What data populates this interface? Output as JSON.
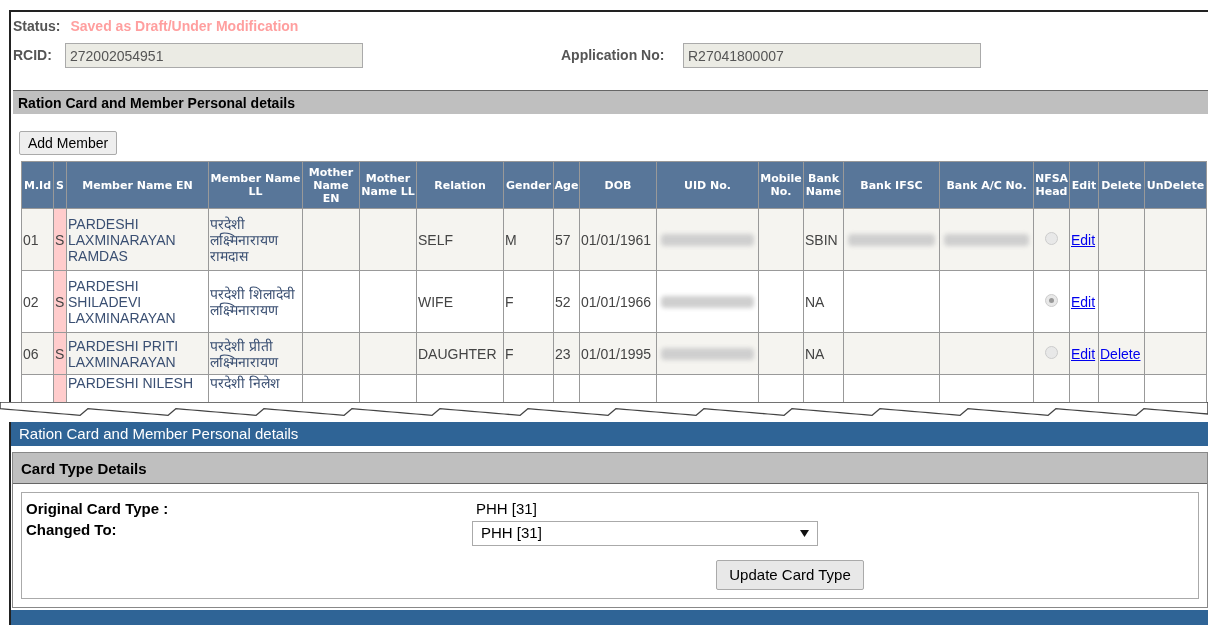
{
  "status": {
    "label": "Status:",
    "value": "Saved as Draft/Under Modification"
  },
  "rcid": {
    "label": "RCID:",
    "value": "272002054951"
  },
  "application_no": {
    "label": "Application No:",
    "value": "R27041800007"
  },
  "section_title": "Ration Card and Member Personal details",
  "add_member_button": "Add Member",
  "table": {
    "columns": [
      "M.Id",
      "S",
      "Member Name EN",
      "Member Name LL",
      "Mother Name EN",
      "Mother Name LL",
      "Relation",
      "Gender",
      "Age",
      "DOB",
      "UID No.",
      "Mobile No.",
      "Bank Name",
      "Bank IFSC",
      "Bank A/C No.",
      "NFSA Head",
      "Edit",
      "Delete",
      "UnDelete"
    ],
    "rows": [
      {
        "mid": "01",
        "s": "S",
        "name_en": "PARDESHI LAXMINARAYAN RAMDAS",
        "name_ll": "परदेशी लक्ष्मिनारायण रामदास",
        "relation": "SELF",
        "gender": "M",
        "age": "57",
        "dob": "01/01/1961",
        "bank_name": "SBIN",
        "bank_redacted": true,
        "nfsa_head_selected": false,
        "edit": "Edit"
      },
      {
        "mid": "02",
        "s": "S",
        "name_en": "PARDESHI SHILADEVI LAXMINARAYAN",
        "name_ll": "परदेशी शिलादेवी लक्ष्मिनारायण",
        "relation": "WIFE",
        "gender": "F",
        "age": "52",
        "dob": "01/01/1966",
        "bank_name": "NA",
        "bank_redacted": false,
        "nfsa_head_selected": true,
        "edit": "Edit"
      },
      {
        "mid": "06",
        "s": "S",
        "name_en": "PARDESHI PRITI LAXMINARAYAN",
        "name_ll": "परदेशी प्रीती लक्ष्मिनारायण",
        "relation": "DAUGHTER",
        "gender": "F",
        "age": "23",
        "dob": "01/01/1995",
        "bank_name": "NA",
        "bank_redacted": false,
        "nfsa_head_selected": false,
        "edit": "Edit",
        "delete": "Delete"
      }
    ],
    "partial_row": {
      "name_en": "PARDESHI NILESH",
      "name_ll": "परदेशी निलेश"
    }
  },
  "lower_bar_title": "Ration Card and Member Personal details",
  "card_type": {
    "title": "Card Type Details",
    "original_label": "Original Card Type :",
    "original_value": "PHH [31]",
    "changed_label": "Changed To:",
    "changed_value": "PHH [31]",
    "update_button": "Update Card Type"
  }
}
